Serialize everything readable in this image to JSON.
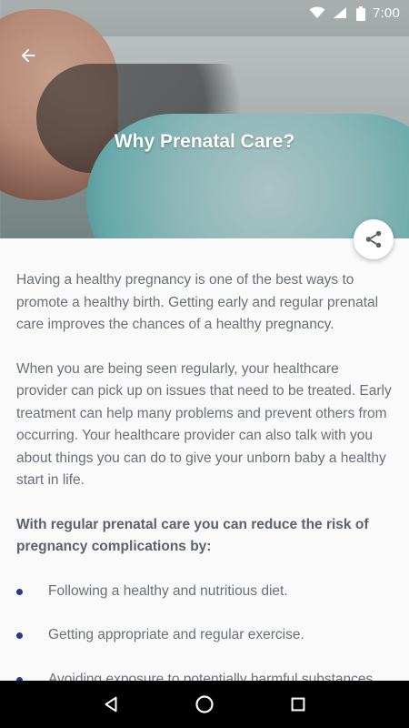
{
  "status_bar": {
    "time": "7:00",
    "icons": [
      "wifi-icon",
      "signal-icon",
      "battery-icon"
    ]
  },
  "header": {
    "title": "Why Prenatal Care?",
    "back_icon": "arrow-left-icon",
    "share_icon": "share-icon"
  },
  "content": {
    "paragraphs": [
      "Having a healthy pregnancy is one of the best ways to promote a healthy birth. Getting early and regular prenatal care improves the chances of a healthy pregnancy.",
      "When you are being seen regularly, your healthcare provider can pick up on issues that need to be treated. Early treatment can help many problems and prevent others from occurring. Your healthcare provider can also talk with you about things you can do to give your unborn baby a healthy start in life."
    ],
    "bold_heading": "With regular prenatal care you can reduce the risk of pregnancy complications by:",
    "list_items": [
      "Following a healthy and nutritious diet.",
      "Getting appropriate and regular exercise.",
      "Avoiding exposure to potentially harmful substances"
    ]
  },
  "nav_bar": {
    "icons": [
      "back-triangle-icon",
      "home-circle-icon",
      "recents-square-icon"
    ]
  },
  "colors": {
    "bullet": "#1f3b8a",
    "body_text": "#6b6f77"
  }
}
